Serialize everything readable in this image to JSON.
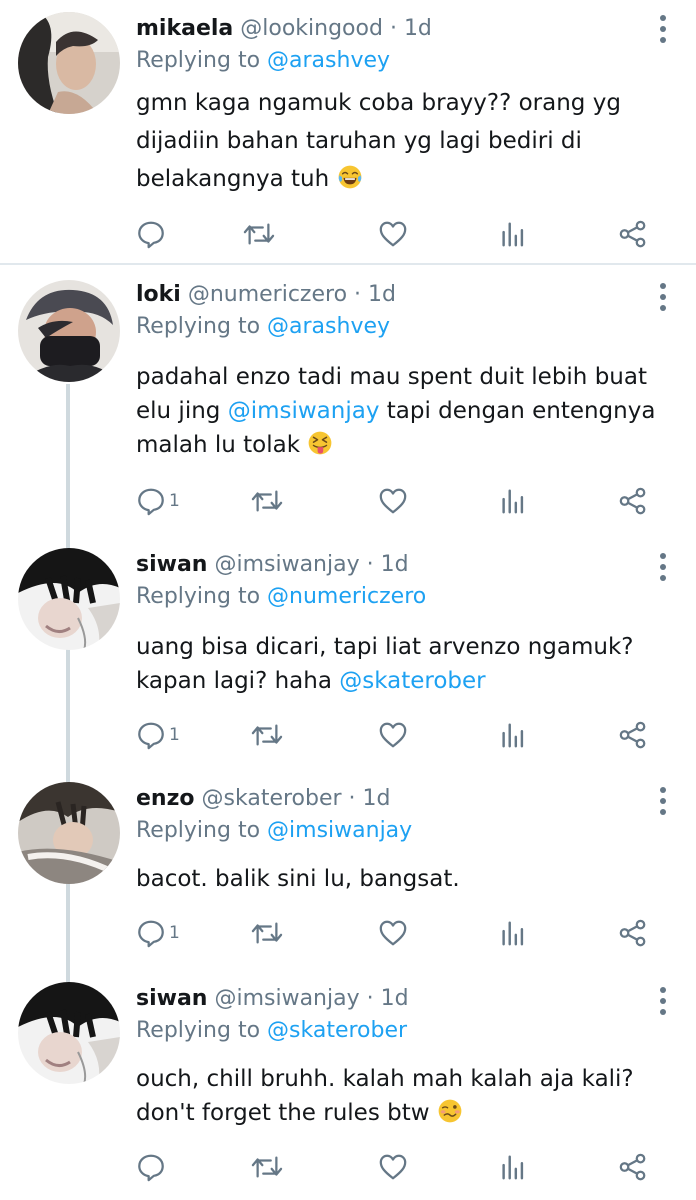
{
  "tweets": [
    {
      "name": "mikaela",
      "handle": "@lookingood",
      "sep": "·",
      "time": "1d",
      "replying_prefix": "Replying to ",
      "replying_to": "@arashvey",
      "text": "gmn kaga ngamuk coba brayy?? orang yg dijadiin bahan taruhan yg lagi bediri di belakangnya tuh",
      "emoji": "joy",
      "reply_count": ""
    },
    {
      "name": "loki",
      "handle": "@numericzero",
      "sep": "·",
      "time": "1d",
      "replying_prefix": "Replying to ",
      "replying_to": "@arashvey",
      "text_parts": [
        "padahal enzo tadi mau spent duit lebih buat elu jing ",
        "@imsiwanjay",
        " tapi dengan entengnya malah lu tolak "
      ],
      "emoji": "tongue",
      "reply_count": "1"
    },
    {
      "name": "siwan",
      "handle": "@imsiwanjay",
      "sep": "·",
      "time": "1d",
      "replying_prefix": "Replying to ",
      "replying_to": "@numericzero",
      "text_parts": [
        "uang bisa dicari, tapi liat arvenzo ngamuk? kapan lagi? haha ",
        "@skaterober"
      ],
      "reply_count": "1"
    },
    {
      "name": "enzo",
      "handle": "@skaterober",
      "sep": "·",
      "time": "1d",
      "replying_prefix": "Replying to ",
      "replying_to": "@imsiwanjay",
      "text": "bacot. balik sini lu, bangsat.",
      "reply_count": "1"
    },
    {
      "name": "siwan",
      "handle": "@imsiwanjay",
      "sep": "·",
      "time": "1d",
      "replying_prefix": "Replying to ",
      "replying_to": "@skaterober",
      "text": "ouch, chill bruhh. kalah mah kalah aja kali? don't forget the rules btw",
      "emoji": "woozy",
      "reply_count": ""
    }
  ],
  "icons": {
    "reply": "reply-icon",
    "retweet": "retweet-icon",
    "like": "heart-icon",
    "analytics": "analytics-icon",
    "share": "share-icon",
    "more": "more-vertical-icon"
  },
  "colors": {
    "link": "#1da1f2",
    "secondary": "#657786",
    "text": "#14171a",
    "divider": "#e1e8ed",
    "thread": "#cfd9de"
  }
}
